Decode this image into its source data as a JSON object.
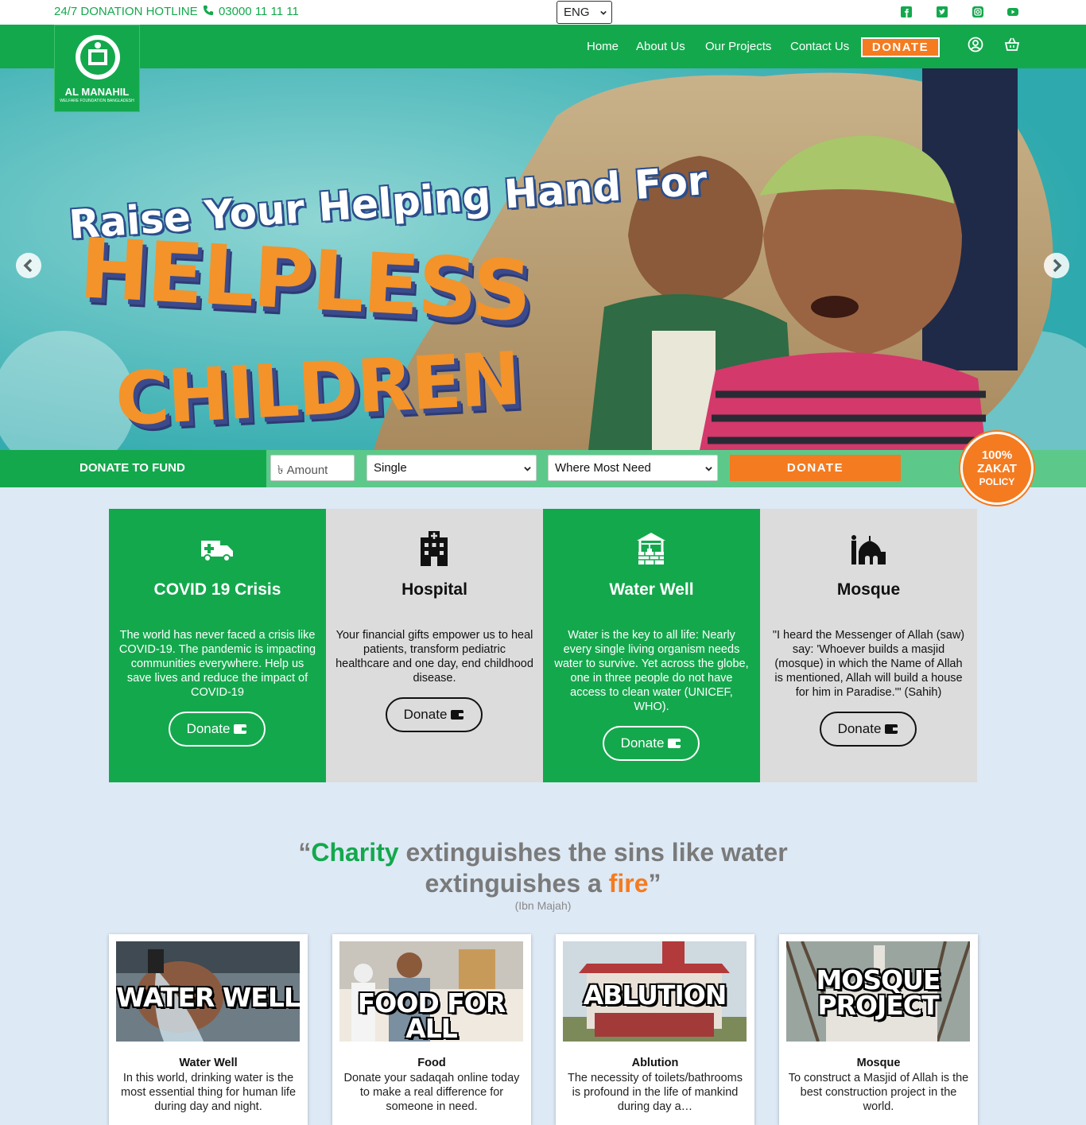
{
  "topbar": {
    "hotline_label": "24/7 DONATION HOTLINE",
    "hotline_number": "03000 11 11 11",
    "language": "ENG",
    "social_icons": [
      "facebook-icon",
      "twitter-icon",
      "instagram-icon",
      "youtube-icon"
    ]
  },
  "logo": {
    "name": "AL MANAHIL",
    "subtitle": "WELFARE FOUNDATION BANGLADESH"
  },
  "nav": {
    "items": [
      "Home",
      "About Us",
      "Our Projects",
      "Contact Us"
    ],
    "donate": "DONATE",
    "icons": [
      "user-icon",
      "basket-icon"
    ]
  },
  "hero": {
    "line1": "Raise Your Helping Hand For",
    "line2": "HELPLESS",
    "line3": "CHILDREN"
  },
  "fund": {
    "label": "DONATE TO FUND",
    "amount_placeholder": "৳ Amount",
    "frequency": "Single",
    "cause": "Where Most Need",
    "donate": "DONATE"
  },
  "zakat": {
    "line1": "100%",
    "line2": "ZAKAT",
    "line3": "POLICY"
  },
  "cards": [
    {
      "title": "COVID 19 Crisis",
      "text": "The world has never faced a crisis like COVID-19. The pandemic is impacting communities everywhere. Help us save lives and reduce the impact of COVID-19",
      "button": "Donate",
      "icon": "ambulance-icon"
    },
    {
      "title": "Hospital",
      "text": "Your financial gifts empower us to heal patients, transform pediatric healthcare and one day, end childhood disease.",
      "button": "Donate",
      "icon": "hospital-icon"
    },
    {
      "title": "Water Well",
      "text": "Water is the key to all life: Nearly every single living organism needs water to survive. Yet across the globe, one in three people do not have access to clean water (UNICEF, WHO).",
      "button": "Donate",
      "icon": "water-well-icon"
    },
    {
      "title": "Mosque",
      "text": "\"I heard the Messenger of Allah (saw) say: 'Whoever builds a masjid (mosque) in which the Name of Allah is mentioned, Allah will build a house for him in Paradise.'\" (Sahih)",
      "button": "Donate",
      "icon": "mosque-icon"
    }
  ],
  "quote": {
    "open": "“",
    "charity": "Charity",
    "middle": " extinguishes the sins like water extinguishes a ",
    "fire": "fire",
    "close": "”",
    "source": "(Ibn Majah)"
  },
  "projects": [
    {
      "image_label": "WATER WELL",
      "title": "Water Well",
      "text": "In this world, drinking water is the most essential thing for human life during day and night."
    },
    {
      "image_label": "FOOD FOR ALL",
      "title": "Food",
      "text": "Donate your sadaqah online today to make a real difference for someone in need."
    },
    {
      "image_label": "ABLUTION",
      "title": "Ablution",
      "text": "The necessity of toilets/bathrooms is profound in the life of mankind during day a…"
    },
    {
      "image_label": "MOSQUE PROJECT",
      "title": "Mosque",
      "text": "To construct a Masjid of Allah is the best construction project in the world."
    }
  ],
  "colors": {
    "brand_green": "#14a84d",
    "accent_orange": "#f47b20",
    "page_bg": "#dde9f5"
  }
}
